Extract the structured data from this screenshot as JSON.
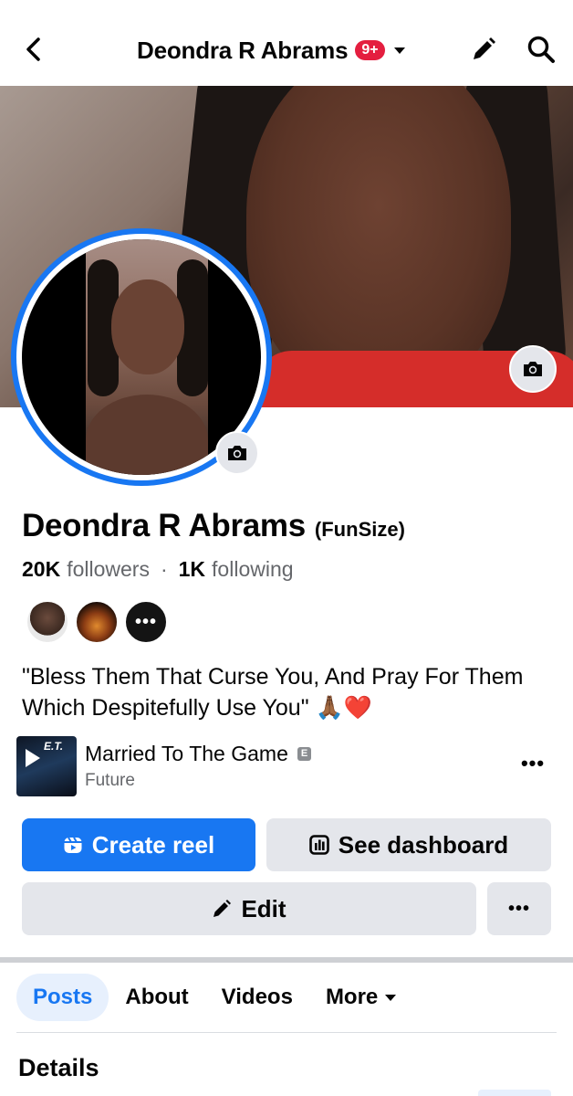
{
  "header": {
    "title": "Deondra R Abrams",
    "notification_badge": "9+"
  },
  "profile": {
    "name": "Deondra R Abrams",
    "alternate_name": "(FunSize)",
    "followers_count": "20K",
    "followers_label": "followers",
    "separator": "·",
    "following_count": "1K",
    "following_label": "following",
    "friends_more": "•••",
    "bio": "\"Bless Them That Curse You, And Pray For Them Which Despitefully Use You\" 🙏🏾❤️"
  },
  "music": {
    "song_title": "Married To The Game",
    "explicit_badge": "E",
    "artist": "Future",
    "album_text": "E.T.",
    "more_label": "•••"
  },
  "actions": {
    "create_reel": "Create reel",
    "see_dashboard": "See dashboard",
    "edit": "Edit",
    "more": "•••"
  },
  "tabs": [
    {
      "label": "Posts",
      "active": true
    },
    {
      "label": "About",
      "active": false
    },
    {
      "label": "Videos",
      "active": false
    },
    {
      "label": "More",
      "active": false
    }
  ],
  "sections": {
    "details_heading": "Details"
  },
  "colors": {
    "primary": "#1877f2",
    "badge": "#e41e3f",
    "secondary_button": "#e4e6eb",
    "muted_text": "#65676b"
  },
  "icons": [
    "back-arrow-icon",
    "chevron-down-icon",
    "pencil-icon",
    "search-icon",
    "camera-icon",
    "reel-icon",
    "dashboard-icon",
    "edit-pencil-icon"
  ]
}
